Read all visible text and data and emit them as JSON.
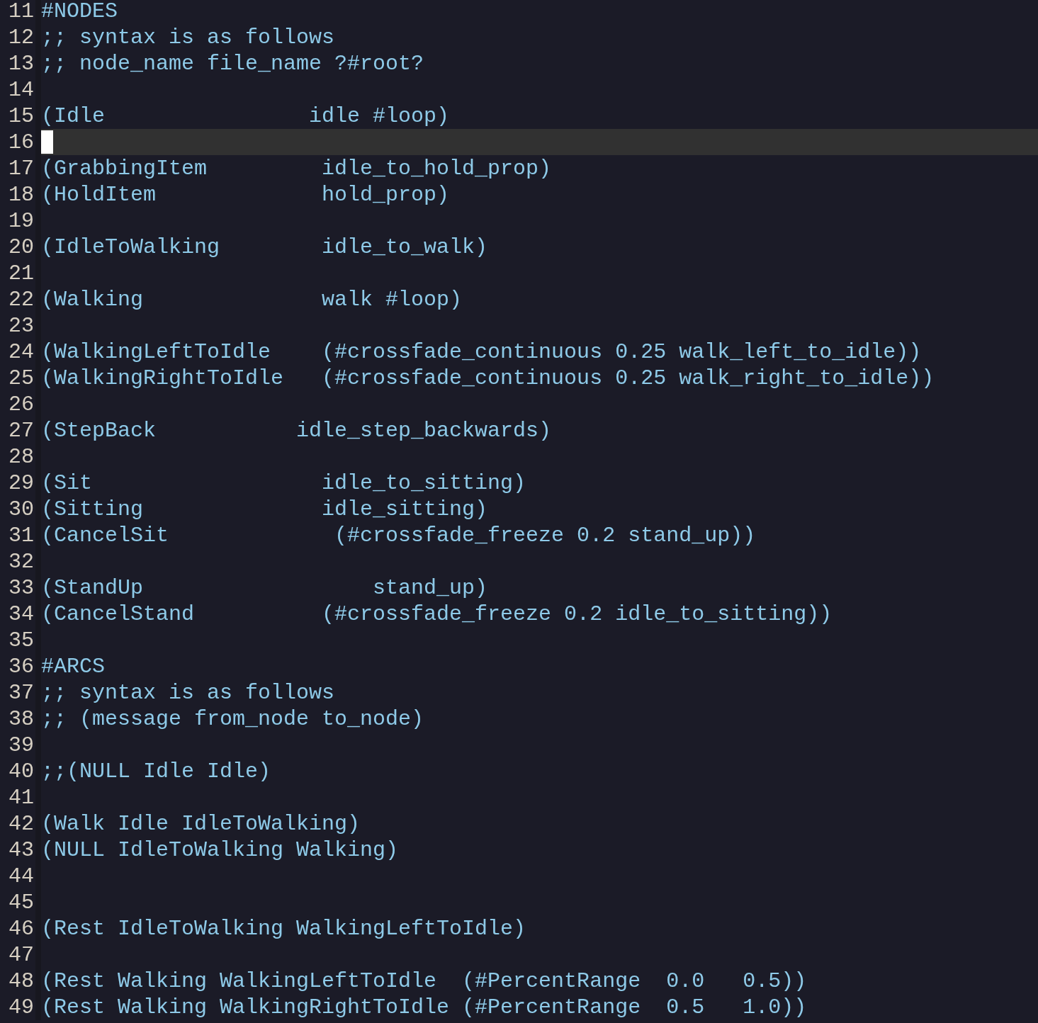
{
  "editor": {
    "lines": [
      {
        "number": "11",
        "text": "#NODES",
        "current": false
      },
      {
        "number": "12",
        "text": ";; syntax is as follows",
        "current": false
      },
      {
        "number": "13",
        "text": ";; node_name file_name ?#root?",
        "current": false
      },
      {
        "number": "14",
        "current": false
      },
      {
        "number": "15",
        "text": "(Idle                idle #loop)",
        "current": false
      },
      {
        "number": "16",
        "current": true
      },
      {
        "number": "17",
        "text": "(GrabbingItem         idle_to_hold_prop)",
        "current": false
      },
      {
        "number": "18",
        "text": "(HoldItem             hold_prop)",
        "current": false
      },
      {
        "number": "19",
        "current": false
      },
      {
        "number": "20",
        "text": "(IdleToWalking        idle_to_walk)",
        "current": false
      },
      {
        "number": "21",
        "current": false
      },
      {
        "number": "22",
        "text": "(Walking              walk #loop)",
        "current": false
      },
      {
        "number": "23",
        "current": false
      },
      {
        "number": "24",
        "text": "(WalkingLeftToIdle    (#crossfade_continuous 0.25 walk_left_to_idle))",
        "current": false
      },
      {
        "number": "25",
        "text": "(WalkingRightToIdle   (#crossfade_continuous 0.25 walk_right_to_idle))",
        "current": false
      },
      {
        "number": "26",
        "current": false
      },
      {
        "number": "27",
        "text": "(StepBack           idle_step_backwards)",
        "current": false
      },
      {
        "number": "28",
        "current": false
      },
      {
        "number": "29",
        "text": "(Sit                  idle_to_sitting)",
        "current": false
      },
      {
        "number": "30",
        "text": "(Sitting              idle_sitting)",
        "current": false
      },
      {
        "number": "31",
        "text": "(CancelSit             (#crossfade_freeze 0.2 stand_up))",
        "current": false
      },
      {
        "number": "32",
        "current": false
      },
      {
        "number": "33",
        "text": "(StandUp                  stand_up)",
        "current": false
      },
      {
        "number": "34",
        "text": "(CancelStand          (#crossfade_freeze 0.2 idle_to_sitting))",
        "current": false
      },
      {
        "number": "35",
        "current": false
      },
      {
        "number": "36",
        "text": "#ARCS",
        "current": false
      },
      {
        "number": "37",
        "text": ";; syntax is as follows",
        "current": false
      },
      {
        "number": "38",
        "text": ";; (message from_node to_node)",
        "current": false
      },
      {
        "number": "39",
        "current": false
      },
      {
        "number": "40",
        "text": ";;(NULL Idle Idle)",
        "current": false
      },
      {
        "number": "41",
        "current": false
      },
      {
        "number": "42",
        "text": "(Walk Idle IdleToWalking)",
        "current": false
      },
      {
        "number": "43",
        "text": "(NULL IdleToWalking Walking)",
        "current": false
      },
      {
        "number": "44",
        "current": false
      },
      {
        "number": "45",
        "current": false
      },
      {
        "number": "46",
        "text": "(Rest IdleToWalking WalkingLeftToIdle)",
        "current": false
      },
      {
        "number": "47",
        "current": false
      },
      {
        "number": "48",
        "text": "(Rest Walking WalkingLeftToIdle  (#PercentRange  0.0   0.5))",
        "current": false
      },
      {
        "number": "49",
        "text": "(Rest Walking WalkingRightToIdle (#PercentRange  0.5   1.0))",
        "current": false
      }
    ]
  }
}
